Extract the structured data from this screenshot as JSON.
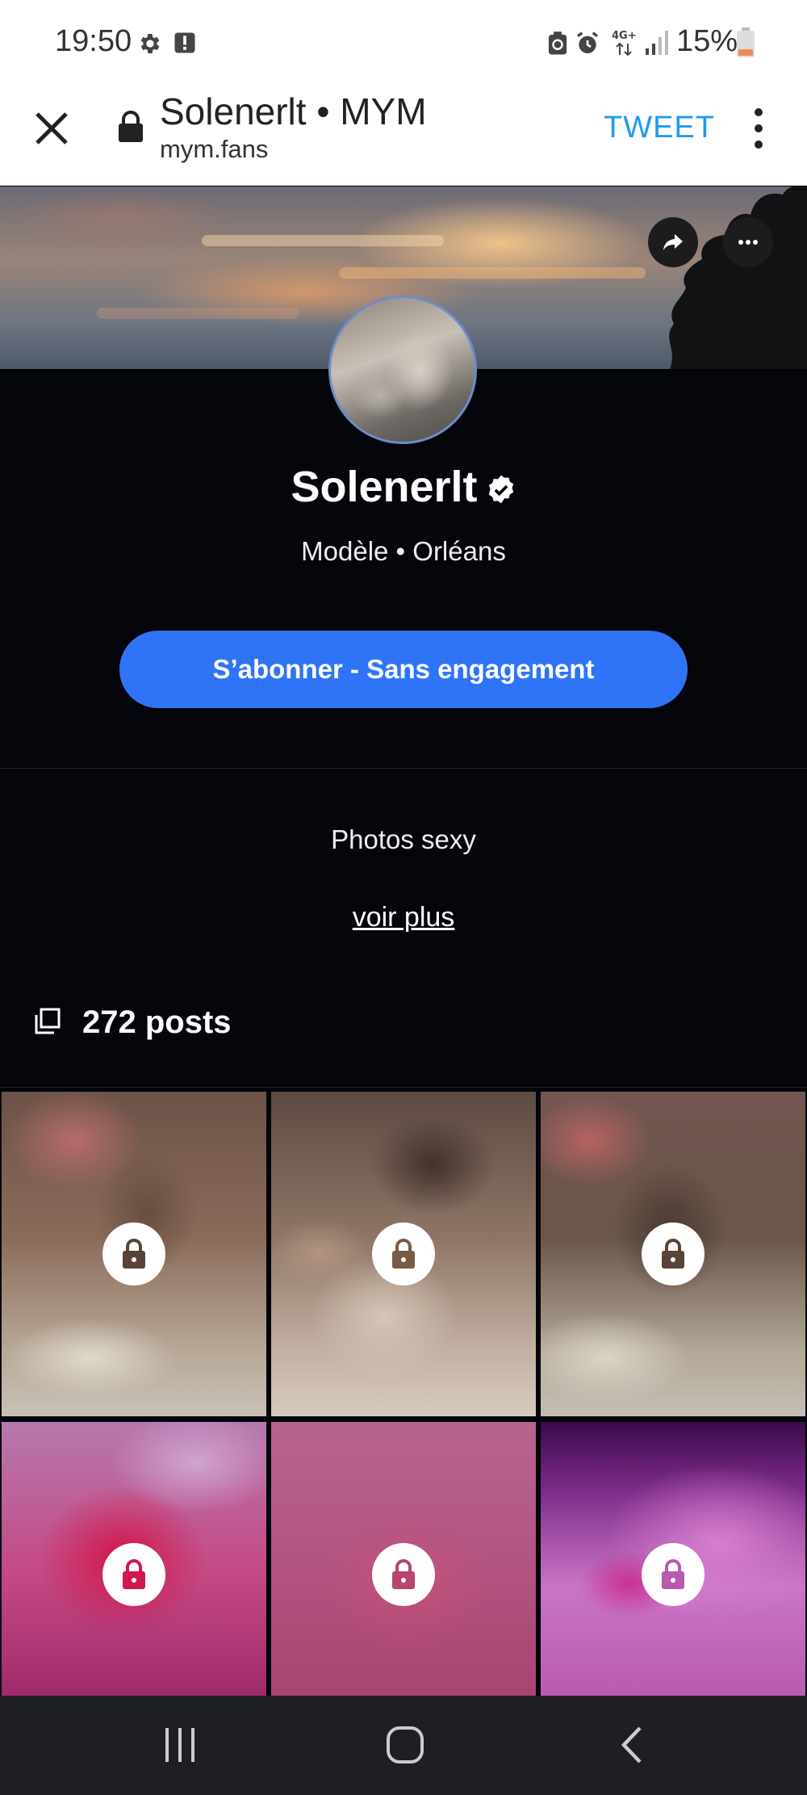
{
  "status_bar": {
    "time": "19:50",
    "battery": "15%",
    "network": "4G+",
    "icons": [
      "gear-icon",
      "alert-icon",
      "data-saver-icon",
      "alarm-icon",
      "network-4g-icon",
      "signal-icon",
      "battery-icon"
    ]
  },
  "toolbar": {
    "title": "Solenerlt • MYM",
    "url": "mym.fans",
    "tweet_label": "TWEET",
    "icons": [
      "close-icon",
      "lock-icon",
      "more-vertical-icon"
    ]
  },
  "profile": {
    "name": "Solenerlt",
    "subtitle": "Modèle • Orléans",
    "subscribe_label": "S’abonner - Sans engagement",
    "bio": "Photos sexy",
    "see_more_label": "voir plus",
    "posts_label": "272 posts",
    "accent_color": "#2f74f6",
    "icons": [
      "share-icon",
      "more-horizontal-icon",
      "verified-icon",
      "posts-stack-icon"
    ]
  },
  "grid": {
    "tiles": [
      {
        "locked": true,
        "lock_color": "#5a4236"
      },
      {
        "locked": true,
        "lock_color": "#7a5a46"
      },
      {
        "locked": true,
        "lock_color": "#5a4236"
      },
      {
        "locked": true,
        "lock_color": "#d1174d"
      },
      {
        "locked": true,
        "lock_color": "#b8456f"
      },
      {
        "locked": true,
        "lock_color": "#b85ab0"
      }
    ]
  },
  "nav_bar": {
    "icons": [
      "recent-apps-icon",
      "home-icon",
      "back-icon"
    ]
  }
}
